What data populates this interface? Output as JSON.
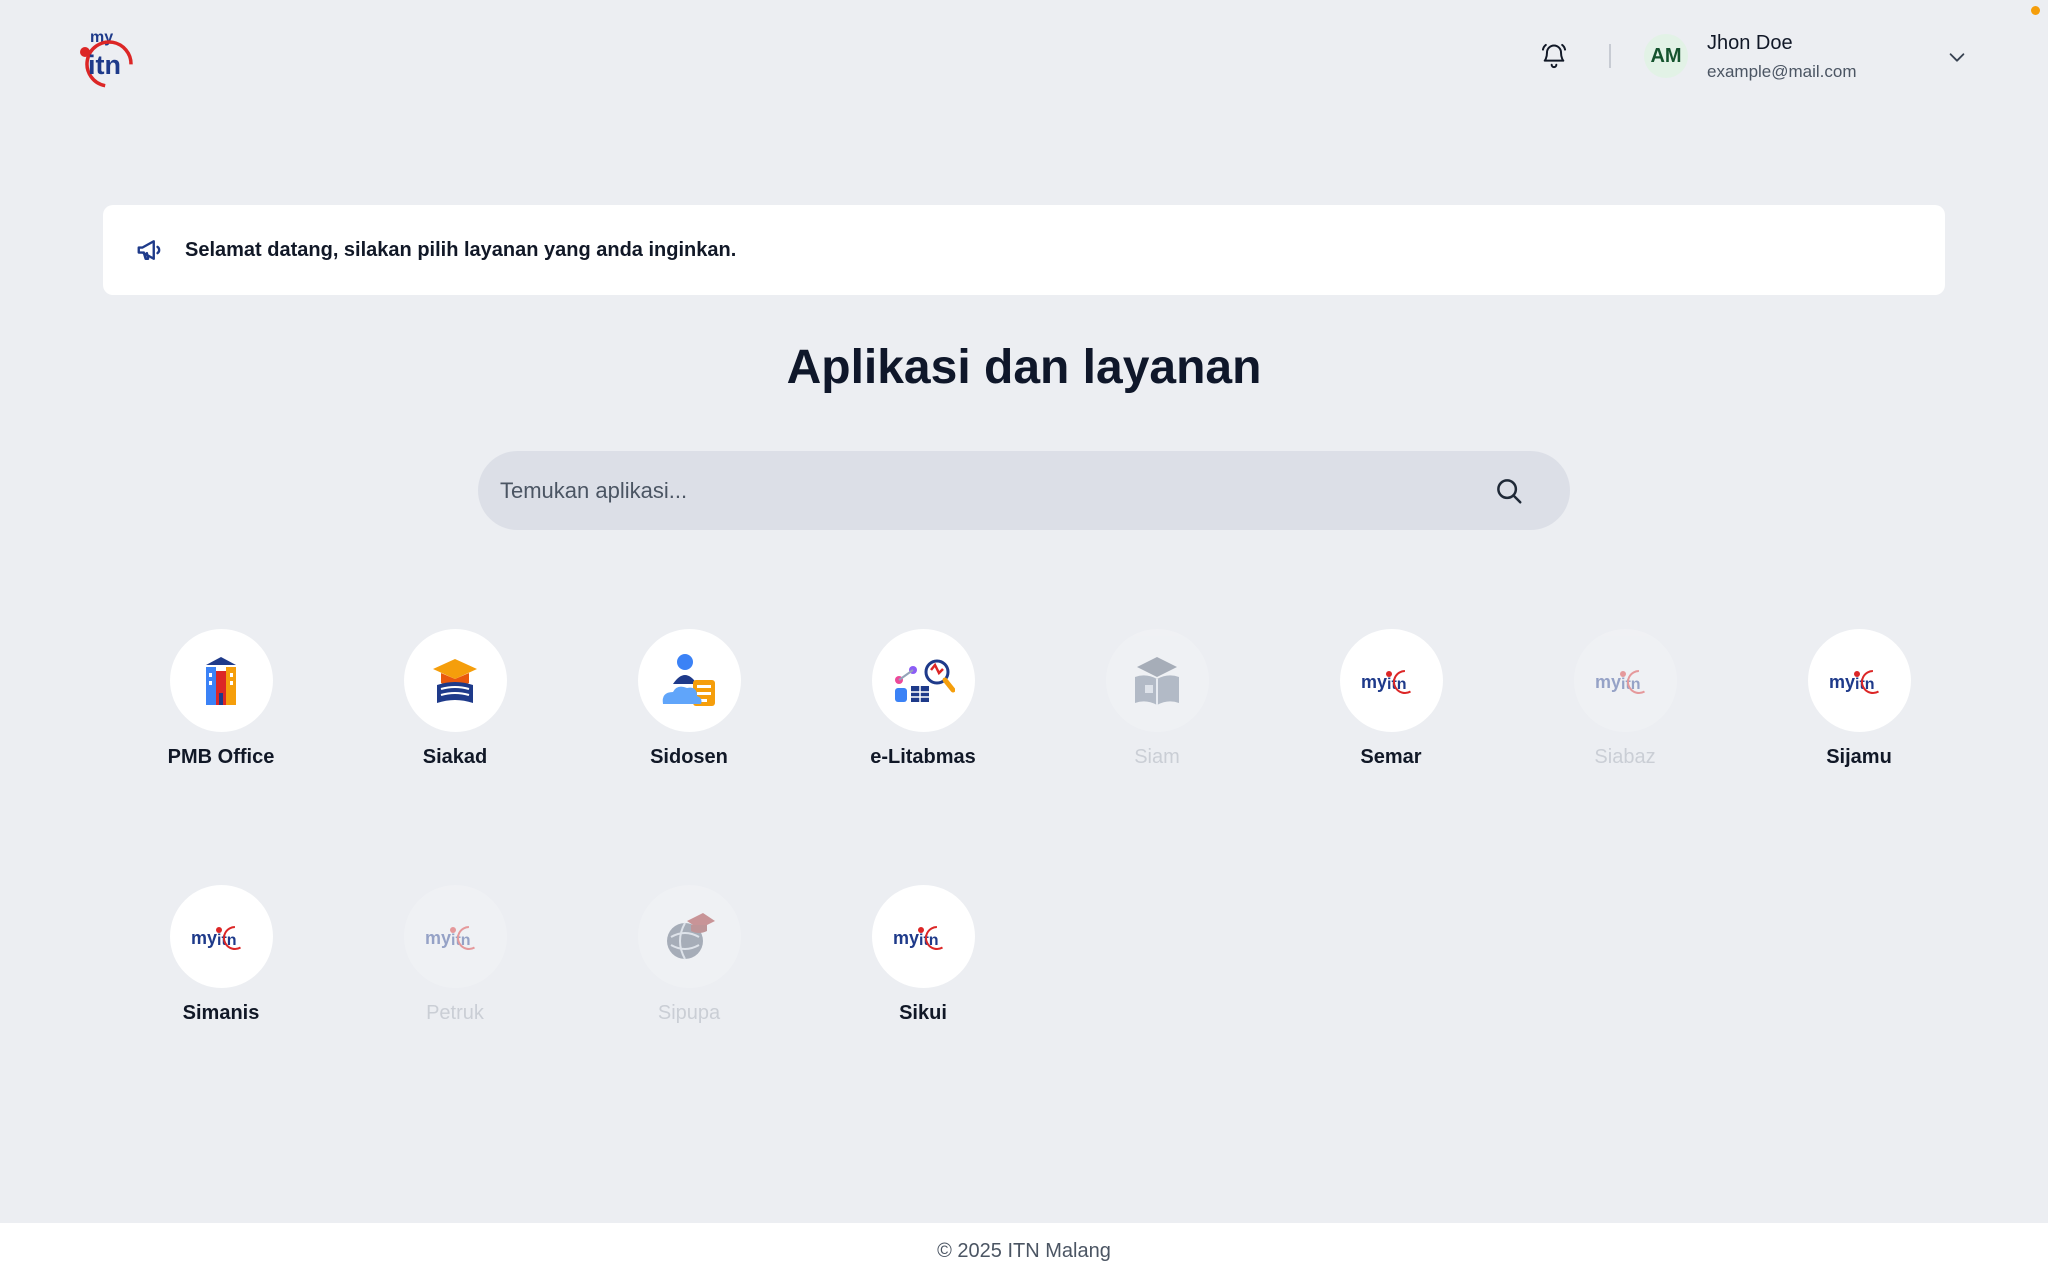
{
  "header": {
    "user": {
      "initials": "AM",
      "name": "Jhon Doe",
      "email": "example@mail.com"
    },
    "icons": {
      "logo": "myitn-logo",
      "notifications": "bell-icon",
      "menu": "chevron-down-icon"
    }
  },
  "announcement": {
    "icon": "megaphone-icon",
    "text": "Selamat datang, silakan pilih layanan yang anda inginkan."
  },
  "main": {
    "title": "Aplikasi dan layanan",
    "search": {
      "placeholder": "Temukan aplikasi...",
      "value": "",
      "icon": "search-icon"
    },
    "apps": [
      {
        "label": "PMB Office",
        "icon": "building-icon",
        "enabled": true
      },
      {
        "label": "Siakad",
        "icon": "graduation-books-icon",
        "enabled": true
      },
      {
        "label": "Sidosen",
        "icon": "lecturer-cloud-icon",
        "enabled": true
      },
      {
        "label": "e-Litabmas",
        "icon": "research-data-icon",
        "enabled": true
      },
      {
        "label": "Siam",
        "icon": "open-book-cap-icon",
        "enabled": false
      },
      {
        "label": "Semar",
        "icon": "myitn-logo-icon",
        "enabled": true
      },
      {
        "label": "Siabaz",
        "icon": "myitn-logo-icon",
        "enabled": false
      },
      {
        "label": "Sijamu",
        "icon": "myitn-logo-icon",
        "enabled": true
      },
      {
        "label": "Simanis",
        "icon": "myitn-logo-icon",
        "enabled": true
      },
      {
        "label": "Petruk",
        "icon": "myitn-logo-icon",
        "enabled": false
      },
      {
        "label": "Sipupa",
        "icon": "globe-cap-icon",
        "enabled": false
      },
      {
        "label": "Sikui",
        "icon": "myitn-logo-icon",
        "enabled": true
      }
    ]
  },
  "footer": {
    "text": "© 2025 ITN Malang"
  },
  "colors": {
    "background": "#eceef2",
    "brand_blue": "#1e3a8a",
    "brand_red": "#dc2626",
    "avatar_bg": "#e2f2e6",
    "status_dot": "#f59e0b"
  }
}
